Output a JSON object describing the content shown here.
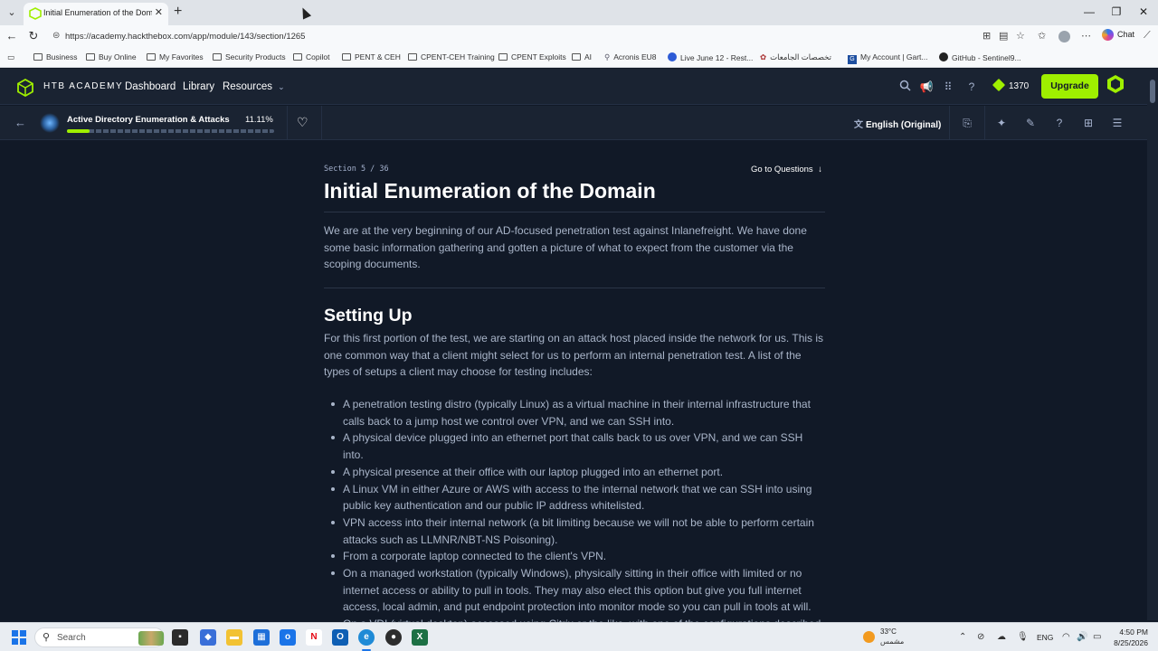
{
  "browser": {
    "tab_title": "Initial Enumeration of the Domain",
    "tab_close": "✕",
    "new_tab": "+",
    "url": "https://academy.hackthebox.com/app/module/143/section/1265",
    "chat_label": "Chat",
    "bookmarks": [
      {
        "label": "Business",
        "icon": "folder-icon"
      },
      {
        "label": "Buy Online",
        "icon": "folder-icon"
      },
      {
        "label": "My Favorites",
        "icon": "folder-icon"
      },
      {
        "label": "Security Products",
        "icon": "folder-icon"
      },
      {
        "label": "Copilot",
        "icon": "folder-icon"
      },
      {
        "label": "PENT & CEH",
        "icon": "folder-icon"
      },
      {
        "label": "CPENT-CEH Training",
        "icon": "folder-icon"
      },
      {
        "label": "CPENT Exploits",
        "icon": "folder-icon"
      },
      {
        "label": "AI",
        "icon": "folder-icon"
      },
      {
        "label": "Acronis EU8",
        "icon": "link-icon"
      },
      {
        "label": "Live June 12 - Rest...",
        "icon": "site-icon"
      },
      {
        "label": "تخصصات الجامعات",
        "icon": "site-icon"
      },
      {
        "label": "My Account | Gart...",
        "icon": "site-icon"
      },
      {
        "label": "GitHub - Sentinel9...",
        "icon": "github-icon"
      }
    ]
  },
  "header": {
    "logo_text": "HTB ACADEMY",
    "nav": {
      "dashboard": "Dashboard",
      "library": "Library",
      "resources": "Resources"
    },
    "cubes": "1370",
    "upgrade": "Upgrade",
    "accent": "#9fef00"
  },
  "module": {
    "title": "Active Directory Enumeration & Attacks",
    "progress_text": "11.11%",
    "progress_value": 0.1111,
    "language": "English (Original)"
  },
  "content": {
    "section_label": "Section 5 / 36",
    "goto_questions": "Go to Questions",
    "title": "Initial Enumeration of the Domain",
    "intro": "We are at the very beginning of our AD-focused penetration test against Inlanefreight. We have done some basic information gathering and gotten a picture of what to expect from the customer via the scoping documents.",
    "setup_heading": "Setting Up",
    "setup_para": "For this first portion of the test, we are starting on an attack host placed inside the network for us. This is one common way that a client might select for us to perform an internal penetration test. A list of the types of setups a client may choose for testing includes:",
    "setup_list": [
      "A penetration testing distro (typically Linux) as a virtual machine in their internal infrastructure that calls back to a jump host we control over VPN, and we can SSH into.",
      "A physical device plugged into an ethernet port that calls back to us over VPN, and we can SSH into.",
      "A physical presence at their office with our laptop plugged into an ethernet port.",
      "A Linux VM in either Azure or AWS with access to the internal network that we can SSH into using public key authentication and our public IP address whitelisted.",
      "VPN access into their internal network (a bit limiting because we will not be able to perform certain attacks such as LLMNR/NBT-NS Poisoning).",
      "From a corporate laptop connected to the client's VPN.",
      "On a managed workstation (typically Windows), physically sitting in their office with limited or no internet access or ability to pull in tools. They may also elect this option but give you full internet access, local admin, and put endpoint protection into monitor mode so you can pull in tools at will.",
      "On a VDI (virtual desktop) accessed using Citrix or the like, with one of the configurations described"
    ]
  },
  "taskbar": {
    "search_placeholder": "Search",
    "weather_temp": "33°C",
    "weather_desc": "مشمس",
    "lang": "ENG",
    "time": "4:50 PM",
    "date": "8/25/2026"
  }
}
